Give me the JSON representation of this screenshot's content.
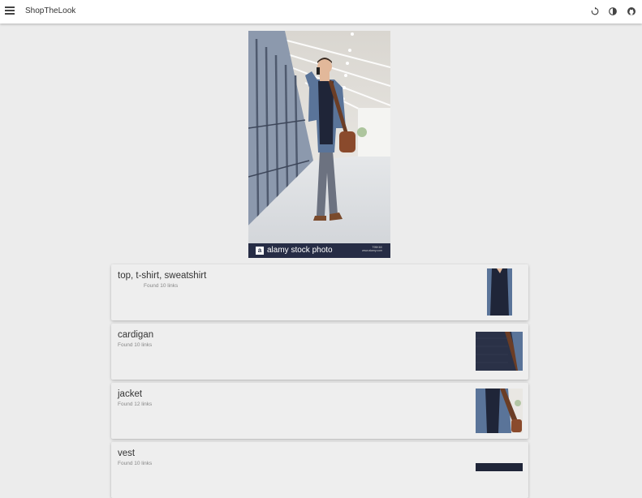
{
  "app": {
    "title": "ShopTheLook"
  },
  "toolbar": {
    "menu_icon": "menu-icon",
    "icons": [
      "refresh-icon",
      "contrast-icon",
      "github-icon"
    ]
  },
  "photo": {
    "watermark_logo": "a",
    "watermark_text": "alamy stock photo",
    "watermark_id": "T95K6X",
    "watermark_url": "www.alamy.com"
  },
  "items": [
    {
      "title": "top, t-shirt, sweatshirt",
      "subtitle": "Found 10 links"
    },
    {
      "title": "cardigan",
      "subtitle": "Found 10 links"
    },
    {
      "title": "jacket",
      "subtitle": "Found 12 links"
    },
    {
      "title": "vest",
      "subtitle": "Found 10 links"
    }
  ],
  "colors": {
    "appbar": "#ffffff",
    "background": "#ececec",
    "card": "#eeeeee",
    "watermark_bar": "#262c45",
    "jacket": "#5a7499",
    "top": "#1f2538"
  }
}
